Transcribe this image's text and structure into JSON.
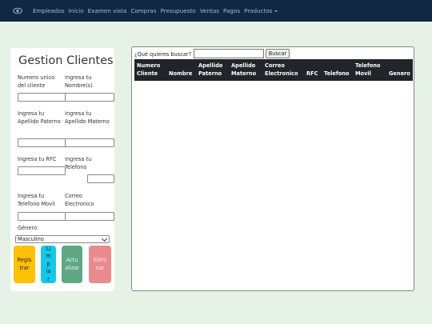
{
  "nav": {
    "logo_icon": "eye-icon",
    "links": [
      "Empleados",
      "Inicio",
      "Examen vista",
      "Compras",
      "Presupuesto",
      "Ventas",
      "Pagos",
      "Productos"
    ]
  },
  "form": {
    "title": "Gestion Clientes",
    "fields": {
      "numero_cliente": "Numero unico del cliente",
      "nombre": "Ingresa tu Nombre(s)",
      "apellido_paterno": "Ingresa tu Apellido Paterno",
      "apellido_materno": "Ingresa tu Apellido Materno",
      "rfc": "Ingresa tu RFC",
      "telefono": "Ingresa tu Telefono",
      "telefono_movil": "Ingresa tu Telefono Movil",
      "correo": "Correo Electronico"
    },
    "genero_label": "Género:",
    "genero_value": "Masculino",
    "buttons": {
      "registrar": "Registrar",
      "limpiar": "Limpiar",
      "actualizar": "Actualizar",
      "eliminar": "Eliminar"
    }
  },
  "table": {
    "search_label": "¿Qué quieres buscar?",
    "search_value": "",
    "search_button": "Buscar",
    "columns": [
      "Numero Cliente",
      "Nombre",
      "Apellido Paterno",
      "Apellido Materno",
      "Correo Electronico",
      "RFC",
      "Telefono",
      "Telefono Movil",
      "Genero"
    ],
    "rows": []
  },
  "colors": {
    "navbar": "#112843",
    "page_bg": "#e5f2e5",
    "registrar": "#ffc107",
    "limpiar": "#17c7ea",
    "actualizar": "#5fa886",
    "eliminar": "#e88a8f",
    "table_header": "#212529"
  }
}
